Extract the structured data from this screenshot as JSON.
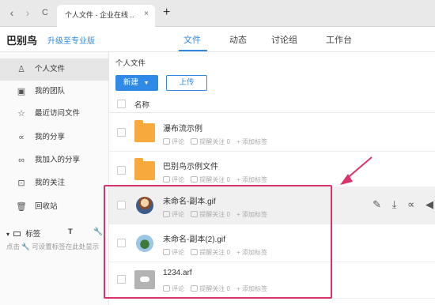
{
  "browser": {
    "back": "‹",
    "forward": "›",
    "reload": "C",
    "tab_title": "个人文件 - 企业在线 ..",
    "tab_close": "×",
    "new_tab": "+"
  },
  "header": {
    "logo": "巴别鸟",
    "upgrade": "升级至专业版",
    "nav": [
      "文件",
      "动态",
      "讨论组",
      "工作台"
    ],
    "active_nav": "文件"
  },
  "sidebar": {
    "items": [
      {
        "label": "个人文件",
        "icon": "person-icon"
      },
      {
        "label": "我的团队",
        "icon": "team-icon"
      },
      {
        "label": "最近访问文件",
        "icon": "star-icon"
      },
      {
        "label": "我的分享",
        "icon": "share-icon"
      },
      {
        "label": "我加入的分享",
        "icon": "joined-share-icon"
      },
      {
        "label": "我的关注",
        "icon": "focus-icon"
      },
      {
        "label": "回收站",
        "icon": "trash-icon"
      }
    ],
    "tags_label": "标签",
    "tags_hint": "点击 🔧 可设置标签在此处显示"
  },
  "main": {
    "breadcrumb": "个人文件",
    "new_button": "新建",
    "upload_button": "上传",
    "col_name": "名称",
    "meta_comment": "评论",
    "meta_remind": "提醒关注 0",
    "meta_tag": "+ 添加标签",
    "files": [
      {
        "name": "瀑布流示例",
        "type": "folder"
      },
      {
        "name": "巴别鸟示例文件",
        "type": "folder"
      },
      {
        "name": "未命名-副本.gif",
        "type": "image"
      },
      {
        "name": "未命名-副本(2).gif",
        "type": "image"
      },
      {
        "name": "1234.arf",
        "type": "cloud"
      }
    ]
  },
  "colors": {
    "accent": "#2f8ae5",
    "annotation": "#d9336b",
    "folder": "#f7a93b"
  }
}
